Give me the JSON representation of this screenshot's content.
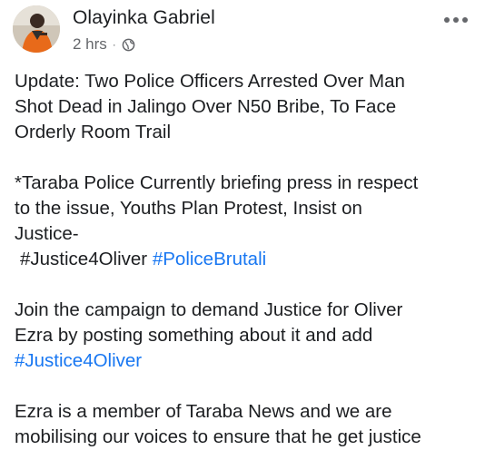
{
  "post": {
    "author_name": "Olayinka Gabriel",
    "timestamp": "2 hrs",
    "separator": "·",
    "privacy_icon": "globe-icon",
    "more_icon": "more-options-icon",
    "link_color": "#1877f2"
  },
  "content": {
    "headline_lines": [
      "Update: Two Police Officers Arrested Over Man",
      "Shot Dead in Jalingo Over N50 Bribe, To Face",
      "Orderly Room Trail"
    ],
    "briefing_lines": [
      "*Taraba Police Currently briefing press in respect",
      "to the issue, Youths Plan Protest, Insist on",
      "Justice-"
    ],
    "hashtags_line": {
      "tag1": "#Justice4Oliver",
      "tag2": "#PoliceBrutali"
    },
    "campaign_lines": [
      "Join the campaign to demand Justice for Oliver",
      "Ezra by posting something about it and add"
    ],
    "campaign_tag": "#Justice4Oliver",
    "member_lines": [
      "Ezra is a member of Taraba News and we are",
      "mobilising our voices to ensure that he get justice"
    ]
  }
}
